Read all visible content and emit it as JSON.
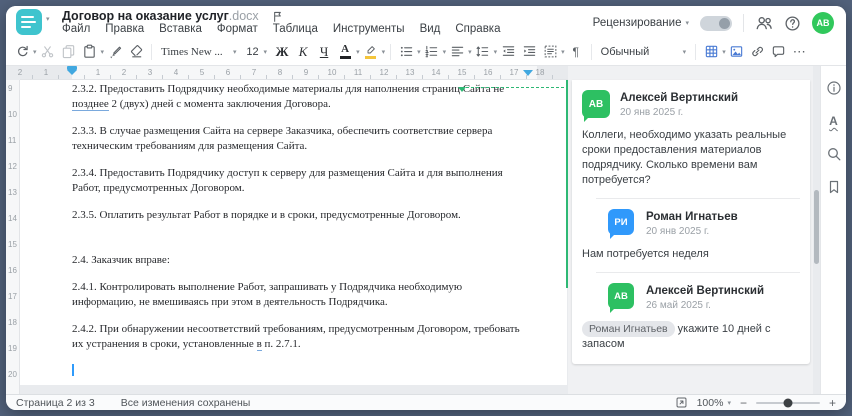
{
  "window": {
    "title": "Договор на оказание услуг",
    "title_ext": ".docx"
  },
  "menu": {
    "items": [
      "Файл",
      "Правка",
      "Вставка",
      "Формат",
      "Таблица",
      "Инструменты",
      "Вид",
      "Справка"
    ]
  },
  "header_right": {
    "review_label": "Рецензирование"
  },
  "user": {
    "initials": "АВ"
  },
  "toolbar": {
    "font_name": "Times New ...",
    "font_size": "12",
    "bold": "Ж",
    "italic": "К",
    "underline": "Ч",
    "font_color_letter": "А",
    "style_name": "Обычный",
    "pilcrow": "¶",
    "more": "⋯"
  },
  "ruler": {
    "h_left": [
      "2",
      "1"
    ],
    "h_main": [
      "1",
      "2",
      "3",
      "4",
      "5",
      "6",
      "7",
      "8",
      "9",
      "10",
      "11",
      "12",
      "13",
      "14",
      "15",
      "16",
      "17",
      "18"
    ],
    "v": [
      "9",
      "10",
      "11",
      "12",
      "13",
      "14",
      "15",
      "16",
      "17",
      "18",
      "19",
      "20"
    ]
  },
  "doc": {
    "p1": {
      "before": "2.3.2. Предоставить Подрядчику необходимые материалы для наполнения страниц Сайта не\n",
      "tracked": "позднее",
      "after": " 2 (двух) дней с момента заключения Договора."
    },
    "p2": "2.3.3. В случае размещения Сайта на сервере Заказчика, обеспечить соответствие сервера\nтехническим требованиям для размещения Сайта.",
    "p3": "2.3.4. Предоставить Подрядчику доступ к серверу для размещения Сайта и для выполнения\nРабот, предусмотренных Договором.",
    "p4": "2.3.5. Оплатить результат Работ в порядке и в сроки, предусмотренные Договором.",
    "p5": "2.4. Заказчик вправе:",
    "p6": "2.4.1. Контролировать выполнение Работ, запрашивать у Подрядчика необходимую\nинформацию, не вмешиваясь при этом в деятельность Подрядчика.",
    "p7": {
      "before": "2.4.2. При обнаружении несоответствий требованиям, предусмотренным Договором, требовать\nих устранения в сроки, установленные ",
      "tracked": "в",
      "after": " п. 2.7.1."
    }
  },
  "comments": {
    "thread": {
      "author": "Алексей Вертинский",
      "initials": "АВ",
      "date": "20 янв 2025 г.",
      "text": "Коллеги, необходимо указать реальные сроки предоставления материалов подрядчику. Сколько времени вам потребуется?",
      "replies": [
        {
          "author": "Роман Игнатьев",
          "initials": "РИ",
          "date": "20 янв 2025 г.",
          "text": "Нам потребуется неделя"
        },
        {
          "author": "Алексей Вертинский",
          "initials": "АВ",
          "date": "26 май 2025 г.",
          "mention": "Роман Игнатьев",
          "text": "укажите 10 дней с запасом"
        }
      ]
    }
  },
  "statusbar": {
    "page": "Страница 2 из 3",
    "saved": "Все изменения сохранены",
    "zoom": "100%"
  },
  "colors": {
    "brand_teal": "#3fc4ce",
    "accent_green": "#2eb874",
    "avatar_green": "#2dc062",
    "avatar_blue": "#3099fb",
    "icon_blue": "#4a7bd4",
    "indent_marker_blue": "#41a8e0"
  }
}
